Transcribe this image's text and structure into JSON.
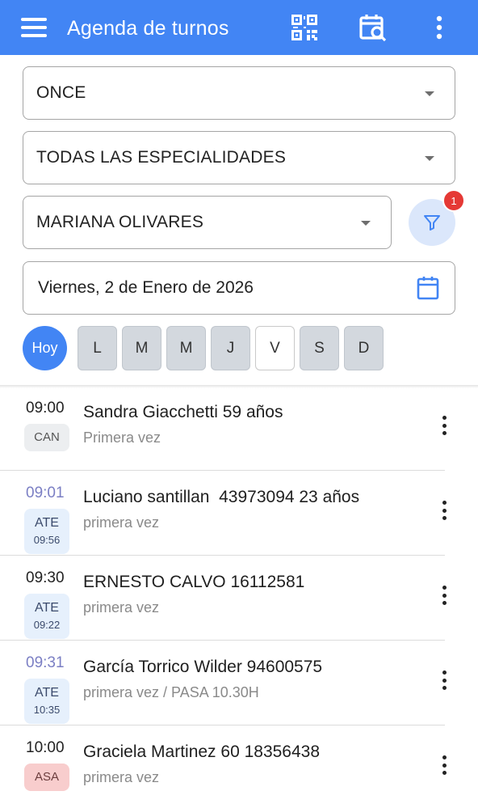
{
  "appbar": {
    "title": "Agenda de turnos",
    "icons": [
      "menu-icon",
      "qr-code-icon",
      "calendar-search-icon",
      "more-vert-icon"
    ],
    "color": "#4285f4"
  },
  "filters": {
    "location": "ONCE",
    "specialty": "TODAS LAS ESPECIALIDADES",
    "professional": "MARIANA OLIVARES",
    "filter_badge": "1",
    "date": "Viernes, 2 de Enero de 2026"
  },
  "week": {
    "today_label": "Hoy",
    "days": [
      "L",
      "M",
      "M",
      "J",
      "V",
      "S",
      "D"
    ],
    "selected": "V"
  },
  "appointments": [
    {
      "time": "09:00",
      "status": "CAN",
      "status_time": "",
      "name": "Sandra Giacchetti 59 años",
      "note": "Primera vez"
    },
    {
      "time": "09:01",
      "status": "ATE",
      "status_time": "09:56",
      "name": "Luciano santillan  43973094 23 años",
      "note": "primera vez"
    },
    {
      "time": "09:30",
      "status": "ATE",
      "status_time": "09:22",
      "name": "ERNESTO CALVO 16112581",
      "note": "primera vez"
    },
    {
      "time": "09:31",
      "status": "ATE",
      "status_time": "10:35",
      "name": "García Torrico Wilder 94600575",
      "note": "primera vez / PASA 10.30H"
    },
    {
      "time": "10:00",
      "status": "ASA",
      "status_time": "",
      "name": "Graciela Martinez 60 18356438",
      "note": "primera vez"
    }
  ],
  "colors": {
    "accent": "#4285f4",
    "status_can": "#eceef0",
    "status_ate": "#e6f0fc",
    "status_asa": "#f8cdcd",
    "badge": "#e53935"
  }
}
